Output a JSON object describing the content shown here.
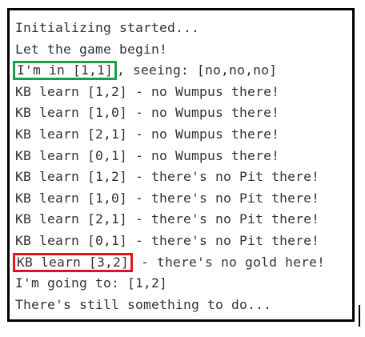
{
  "console": {
    "lines": [
      {
        "text": "Initializing started..."
      },
      {
        "text": "Let the game begin!"
      },
      {
        "highlight": "I'm in [1,1]",
        "rest": ", seeing: [no,no,no]"
      },
      {
        "text": "KB learn [1,2] - no Wumpus there!"
      },
      {
        "text": "KB learn [1,0] - no Wumpus there!"
      },
      {
        "text": "KB learn [2,1] - no Wumpus there!"
      },
      {
        "text": "KB learn [0,1] - no Wumpus there!"
      },
      {
        "text": "KB learn [1,2] - there's no Pit there!"
      },
      {
        "text": "KB learn [1,0] - there's no Pit there!"
      },
      {
        "text": "KB learn [2,1] - there's no Pit there!"
      },
      {
        "text": "KB learn [0,1] - there's no Pit there!"
      },
      {
        "highlight": "KB learn [3,2]",
        "rest": " - there's no gold here!"
      },
      {
        "text": "I'm going to: [1,2]"
      },
      {
        "text": "There's still something to do..."
      }
    ]
  },
  "colors": {
    "frame": "#000000",
    "text": "#333333",
    "highlight_position": "#1aa046",
    "highlight_gold": "#e0161b"
  }
}
